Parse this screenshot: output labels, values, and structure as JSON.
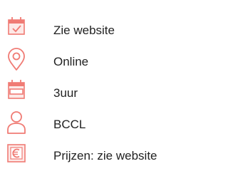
{
  "accent_color": "#f07b74",
  "accent_fill": "#fde9e7",
  "items": [
    {
      "icon": "calendar-check-icon",
      "label": "Zie website"
    },
    {
      "icon": "location-pin-icon",
      "label": "Online"
    },
    {
      "icon": "calendar-duration-icon",
      "label": "3uur"
    },
    {
      "icon": "person-icon",
      "label": "BCCL"
    },
    {
      "icon": "euro-icon",
      "label": "Prijzen: zie website"
    }
  ]
}
